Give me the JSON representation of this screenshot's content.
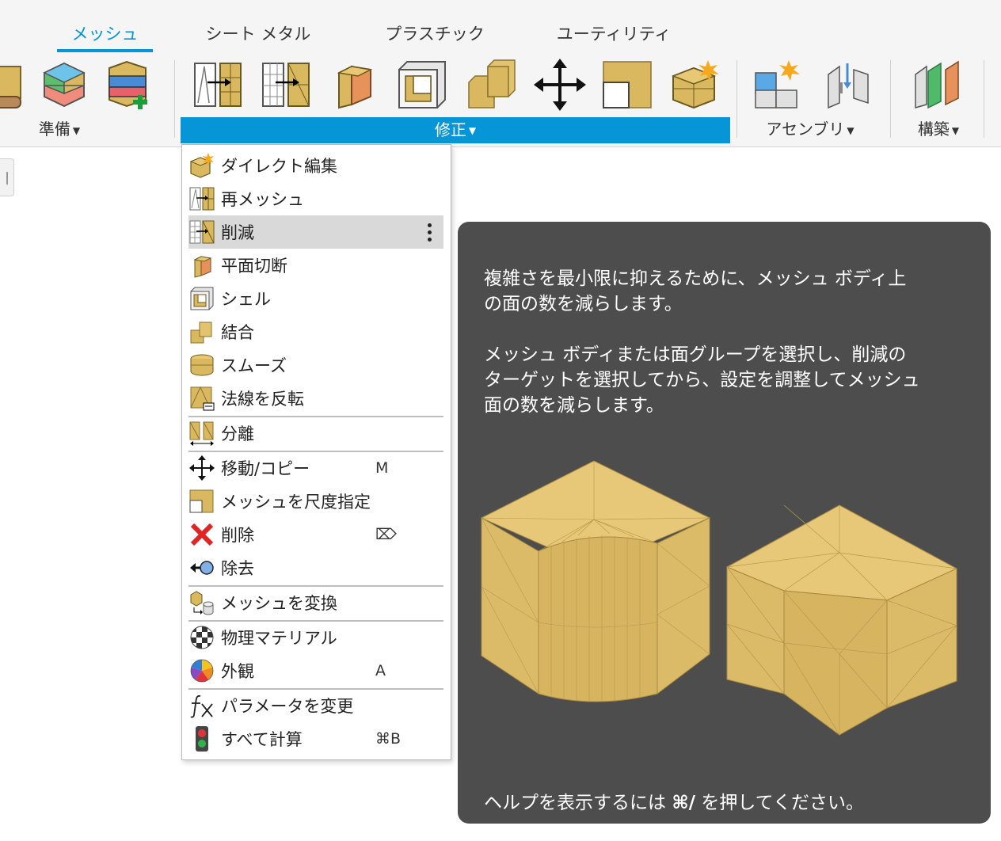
{
  "ribbon": {
    "tabs": [
      {
        "label": "メッシュ",
        "active": true
      },
      {
        "label": "シート メタル",
        "active": false
      },
      {
        "label": "プラスチック",
        "active": false
      },
      {
        "label": "ユーティリティ",
        "active": false
      }
    ],
    "groups": {
      "prepare": "準備",
      "modify": "修正",
      "assemble": "アセンブリ",
      "construct": "構築"
    },
    "accent_color": "#0696d7"
  },
  "menu": {
    "items": [
      {
        "label": "ダイレクト編集",
        "icon": "direct-edit-icon"
      },
      {
        "label": "再メッシュ",
        "icon": "remesh-icon"
      },
      {
        "label": "削減",
        "icon": "reduce-icon",
        "highlighted": true
      },
      {
        "label": "平面切断",
        "icon": "plane-cut-icon"
      },
      {
        "label": "シェル",
        "icon": "shell-icon"
      },
      {
        "label": "結合",
        "icon": "combine-icon"
      },
      {
        "label": "スムーズ",
        "icon": "smooth-icon"
      },
      {
        "label": "法線を反転",
        "icon": "reverse-normal-icon"
      },
      {
        "label": "分離",
        "icon": "separate-icon"
      },
      {
        "label": "移動/コピー",
        "icon": "move-icon",
        "shortcut": "M"
      },
      {
        "label": "メッシュを尺度指定",
        "icon": "scale-icon"
      },
      {
        "label": "削除",
        "icon": "delete-icon",
        "shortcut": "⌦"
      },
      {
        "label": "除去",
        "icon": "remove-icon"
      },
      {
        "label": "メッシュを変換",
        "icon": "convert-mesh-icon"
      },
      {
        "label": "物理マテリアル",
        "icon": "physical-material-icon"
      },
      {
        "label": "外観",
        "icon": "appearance-icon",
        "shortcut": "A"
      },
      {
        "label": "パラメータを変更",
        "icon": "fx-icon"
      },
      {
        "label": "すべて計算",
        "icon": "compute-all-icon",
        "shortcut": "⌘B"
      }
    ]
  },
  "tooltip": {
    "line1": "複雑さを最小限に抑えるために、メッシュ ボディ上",
    "line2": "の面の数を減らします。",
    "line3": "メッシュ ボディまたは面グループを選択し、削減の",
    "line4": "ターゲットを選択してから、設定を調整してメッシュ",
    "line5": "面の数を減らします。",
    "help_prefix": "ヘルプを表示するには ",
    "help_key": "⌘/",
    "help_suffix": " を押してください。"
  }
}
